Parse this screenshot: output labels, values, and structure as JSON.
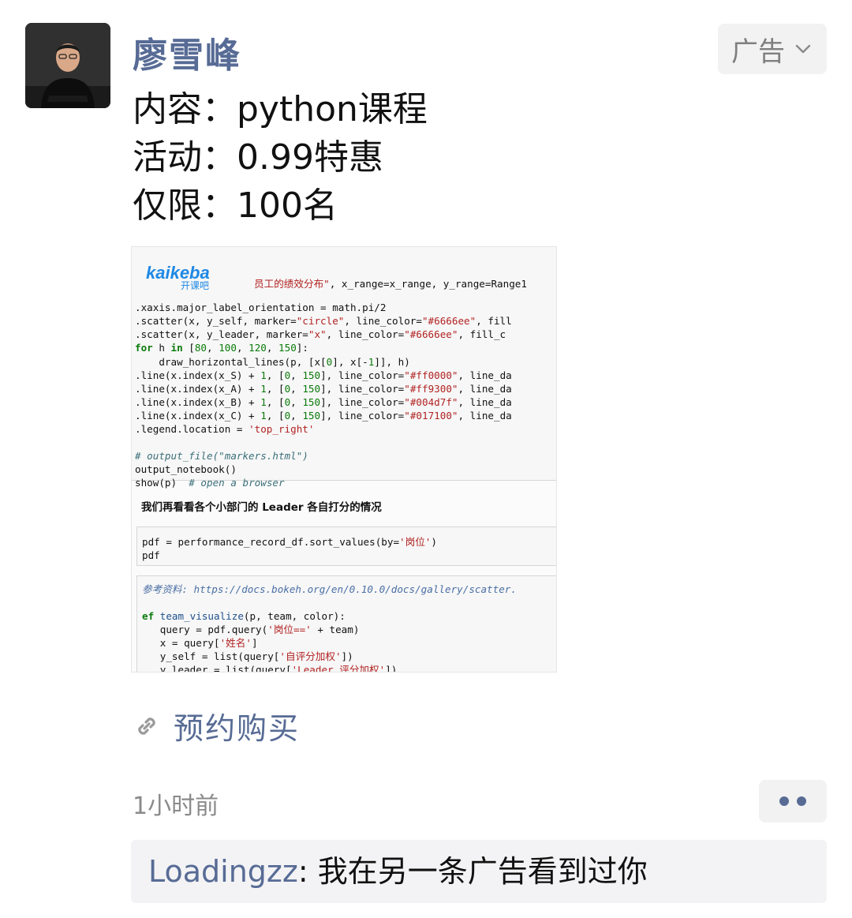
{
  "post": {
    "author": "廖雪峰",
    "ad_label": "广告",
    "lines": [
      "内容：python课程",
      "活动：0.99特惠",
      "仅限：100名"
    ],
    "link_text": "预约购买",
    "time": "1小时前"
  },
  "screenshot": {
    "brand": "kaikeba",
    "brand_sub": "开课吧",
    "md_heading": "我们再看看各个小部门的 Leader 各自打分的情况"
  },
  "comment": {
    "user": "Loadingzz",
    "separator": ": ",
    "text": "我在另一条广告看到过你"
  },
  "icons": {
    "link": "link-icon",
    "more": "more-dots-icon",
    "chevron": "chevron-down-icon"
  },
  "colors": {
    "link_blue": "#576b95",
    "bg_gray": "#f2f2f2"
  }
}
